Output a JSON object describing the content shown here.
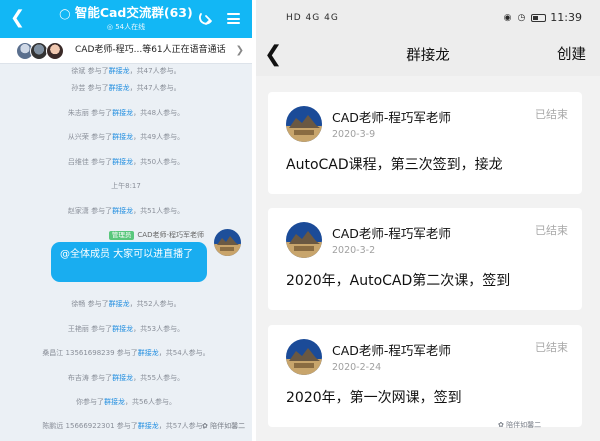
{
  "left": {
    "header": {
      "title": "智能Cad交流群(63)",
      "online": "54人在线",
      "back_icon": "back-arrow-icon",
      "qq_icon": "qq-penguin-icon",
      "menu_icon": "menu-icon"
    },
    "voice_bar": {
      "text": "CAD老师-程巧...等61人正在语音通话"
    },
    "messages_before": [
      {
        "name": "徐斌",
        "count": "共47人参与。"
      },
      {
        "name": "孙芸",
        "count": "共47人参与。"
      },
      {
        "name": "朱志丽",
        "count": "共48人参与。"
      },
      {
        "name": "从兴荣",
        "count": "共49人参与。"
      },
      {
        "name": "吕维佳",
        "count": "共50人参与。"
      }
    ],
    "time_label": "上午8:17",
    "messages_mid": [
      {
        "name": "赵家潇",
        "count": "共51人参与。"
      }
    ],
    "chat": {
      "badge": "管理员",
      "sender": "CAD老师-程巧军老师",
      "bubble": "@全体成员 大家可以进直播了"
    },
    "messages_after": [
      {
        "name": "徐畅",
        "count": "共52人参与。"
      },
      {
        "name": "王艳丽",
        "count": "共53人参与。"
      },
      {
        "name": "桑昌江 13561698239",
        "count": "共54人参与。"
      },
      {
        "name": "布吉涛",
        "count": "共55人参与。"
      },
      {
        "name": "你",
        "count": "共56人参与。"
      },
      {
        "name": "陈鹏远 15666922301",
        "count": "共57人参与。"
      }
    ],
    "joined_text": "参与了",
    "link_text": "群接龙",
    "watermark": "陪伴如馨二"
  },
  "right": {
    "status_bar": {
      "left": "HD 4G 4G",
      "time": "11:39"
    },
    "nav": {
      "back_icon": "back-chevron-icon",
      "title": "群接龙",
      "create": "创建"
    },
    "cards": [
      {
        "name": "CAD老师-程巧军老师",
        "date": "2020-3-9",
        "status": "已结束",
        "content": "AutoCAD课程，第三次签到，接龙"
      },
      {
        "name": "CAD老师-程巧军老师",
        "date": "2020-3-2",
        "status": "已结束",
        "content": "2020年，AutoCAD第二次课，签到"
      },
      {
        "name": "CAD老师-程巧军老师",
        "date": "2020-2-24",
        "status": "已结束",
        "content": "2020年，第一次网课，签到"
      }
    ],
    "watermark": "陪伴如馨二"
  }
}
